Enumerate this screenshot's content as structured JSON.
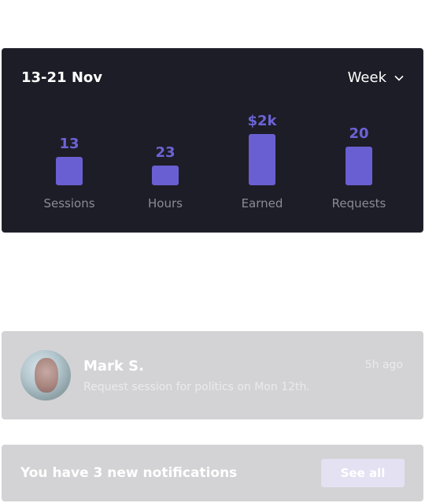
{
  "stats": {
    "date_range": "13-21 Nov",
    "period": "Week",
    "items": [
      {
        "label": "Sessions",
        "value": "13"
      },
      {
        "label": "Hours",
        "value": "23"
      },
      {
        "label": "Earned",
        "value": "$2k"
      },
      {
        "label": "Requests",
        "value": "20"
      }
    ]
  },
  "message": {
    "sender": "Mark S.",
    "time": "5h ago",
    "text": "Request session for politics on Mon 12th."
  },
  "notifications": {
    "text": "You have 3 new notifications",
    "button": "See all"
  },
  "colors": {
    "card_bg": "#1d1d27",
    "accent": "#6a5fd2",
    "muted_card_bg": "#d3d3d5"
  }
}
